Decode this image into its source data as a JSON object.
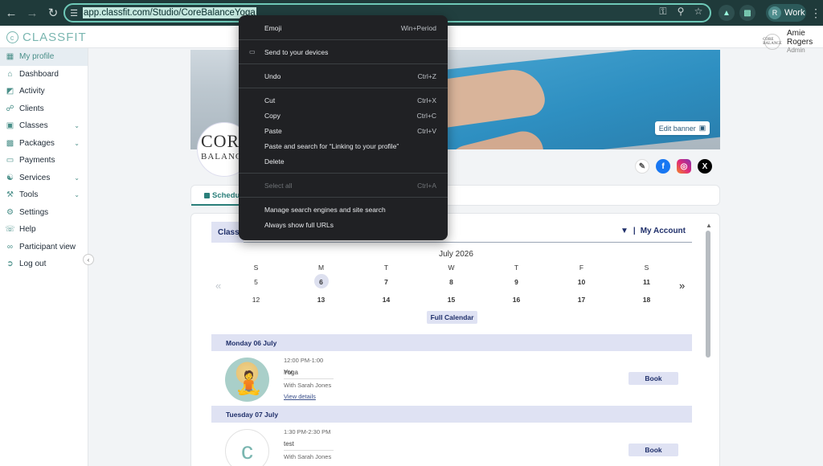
{
  "browser": {
    "url": "app.classfit.com/Studio/CoreBalanceYoga",
    "profile_initial": "R",
    "profile_label": "Work"
  },
  "app": {
    "logo_text": "CLASSFIT",
    "user_name": "Amie Rogers",
    "user_role": "Admin",
    "avatar_text": "CORE BALANCE"
  },
  "sidebar": {
    "items": [
      {
        "label": "My profile"
      },
      {
        "label": "Dashboard"
      },
      {
        "label": "Activity"
      },
      {
        "label": "Clients"
      },
      {
        "label": "Classes"
      },
      {
        "label": "Packages"
      },
      {
        "label": "Payments"
      },
      {
        "label": "Services"
      },
      {
        "label": "Tools"
      },
      {
        "label": "Settings"
      },
      {
        "label": "Help"
      },
      {
        "label": "Participant view"
      },
      {
        "label": "Log out"
      }
    ]
  },
  "profile": {
    "edit_banner": "Edit banner",
    "studio_logo_line1": "CORE",
    "studio_logo_line2": "BALANCE"
  },
  "tabs": {
    "schedule": "Schedule"
  },
  "schedule": {
    "class_title": "Class",
    "my_account": "My Account",
    "month": "July 2026",
    "weekdays": [
      "S",
      "M",
      "T",
      "W",
      "T",
      "F",
      "S"
    ],
    "week1": [
      "5",
      "6",
      "7",
      "8",
      "9",
      "10",
      "11"
    ],
    "week2": [
      "12",
      "13",
      "14",
      "15",
      "16",
      "17",
      "18"
    ],
    "full_calendar": "Full Calendar",
    "days": [
      {
        "header": "Monday 06 July",
        "time": "12:00 PM-1:00 PM",
        "name": "Yoga",
        "instructor": "With Sarah Jones",
        "details": "View details",
        "book": "Book"
      },
      {
        "header": "Tuesday 07 July",
        "time": "1:30 PM-2:30 PM",
        "name": "test",
        "instructor": "With Sarah Jones",
        "book": "Book"
      }
    ]
  },
  "context_menu": {
    "items": [
      {
        "label": "Emoji",
        "shortcut": "Win+Period"
      },
      {
        "label": "Send to your devices"
      },
      {
        "label": "Undo",
        "shortcut": "Ctrl+Z"
      },
      {
        "label": "Cut",
        "shortcut": "Ctrl+X"
      },
      {
        "label": "Copy",
        "shortcut": "Ctrl+C"
      },
      {
        "label": "Paste",
        "shortcut": "Ctrl+V"
      },
      {
        "label": "Paste and search for “Linking to your profile”"
      },
      {
        "label": "Delete"
      },
      {
        "label": "Select all",
        "shortcut": "Ctrl+A"
      },
      {
        "label": "Manage search engines and site search"
      },
      {
        "label": "Always show full URLs"
      }
    ]
  }
}
